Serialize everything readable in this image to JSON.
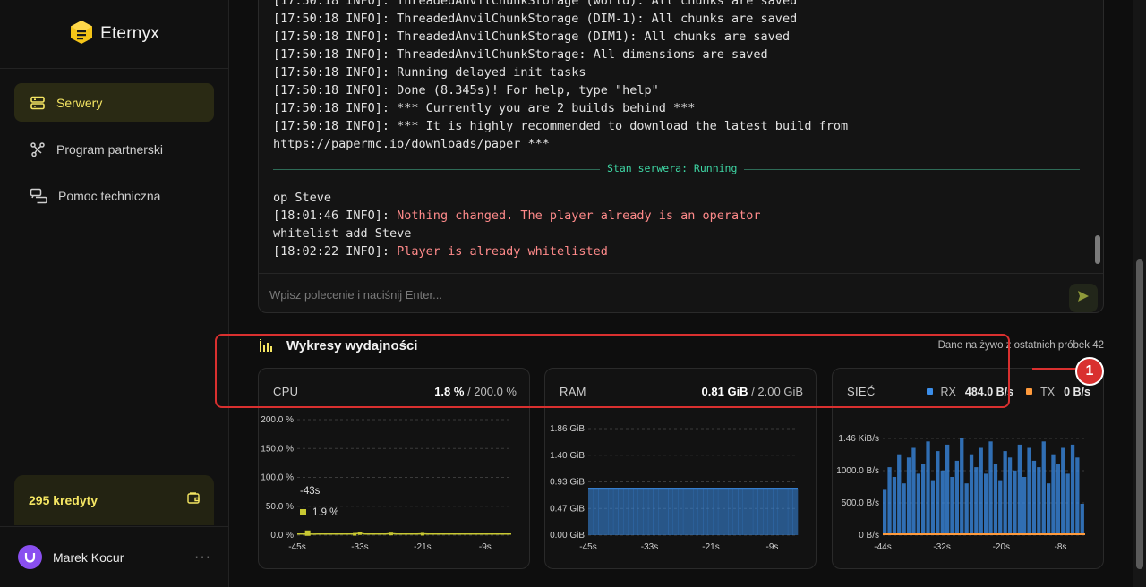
{
  "sidebar": {
    "brand": "Eternyx",
    "items": [
      {
        "label": "Serwery",
        "active": true,
        "icon": "server-icon"
      },
      {
        "label": "Program partnerski",
        "active": false,
        "icon": "share-icon"
      },
      {
        "label": "Pomoc techniczna",
        "active": false,
        "icon": "chat-icon"
      }
    ],
    "credits": "295 kredyty",
    "user": {
      "name": "Marek Kocur",
      "menu": "···"
    }
  },
  "console": {
    "lines_before": [
      {
        "prefix": "[17:50:18 INFO]: ",
        "text": "ThreadedAnvilChunkStorage (world): All chunks are saved"
      },
      {
        "prefix": "[17:50:18 INFO]: ",
        "text": "ThreadedAnvilChunkStorage (DIM-1): All chunks are saved"
      },
      {
        "prefix": "[17:50:18 INFO]: ",
        "text": "ThreadedAnvilChunkStorage (DIM1): All chunks are saved"
      },
      {
        "prefix": "[17:50:18 INFO]: ",
        "text": "ThreadedAnvilChunkStorage: All dimensions are saved"
      },
      {
        "prefix": "[17:50:18 INFO]: ",
        "text": "Running delayed init tasks"
      },
      {
        "prefix": "[17:50:18 INFO]: ",
        "text": "Done (8.345s)! For help, type \"help\""
      },
      {
        "prefix": "[17:50:18 INFO]: ",
        "text": "*** Currently you are 2 builds behind ***"
      },
      {
        "prefix": "[17:50:18 INFO]: ",
        "text": "*** It is highly recommended to download the latest build from"
      },
      {
        "prefix": "",
        "text": "https://papermc.io/downloads/paper ***"
      }
    ],
    "divider_label": "Stan serwera: Running",
    "lines_after": [
      {
        "prefix": "",
        "text": "op Steve",
        "warn": false
      },
      {
        "prefix": "[18:01:46 INFO]: ",
        "text": "Nothing changed. The player already is an operator",
        "warn": true
      },
      {
        "prefix": "",
        "text": "whitelist add Steve",
        "warn": false
      },
      {
        "prefix": "[18:02:22 INFO]: ",
        "text": "Player is already whitelisted",
        "warn": true
      }
    ],
    "input_placeholder": "Wpisz polecenie i naciśnij Enter..."
  },
  "performance": {
    "title": "Wykresy wydajności",
    "subtitle": "Dane na żywo z ostatnich próbek 42",
    "annotation_number": "1"
  },
  "cards": {
    "cpu": {
      "name": "CPU",
      "value": "1.8 %",
      "max": " / 200.0 %",
      "tooltip_time": "-43s",
      "tooltip_value": "1.9 %"
    },
    "ram": {
      "name": "RAM",
      "value": "0.81 GiB",
      "max": " / 2.00 GiB"
    },
    "net": {
      "name": "SIEĆ",
      "rx_label": "RX",
      "rx_value": "484.0 B/s",
      "tx_label": "TX",
      "tx_value": "0 B/s"
    }
  },
  "colors": {
    "accent": "#f5e663",
    "rx": "#3b8eea",
    "tx": "#ff9a3c",
    "cpu": "#c8c832",
    "annotation": "#d9302f"
  },
  "chart_data": [
    {
      "type": "line",
      "title": "CPU",
      "x": [
        -45,
        -44,
        -43,
        -42,
        -41,
        -40,
        -39,
        -38,
        -37,
        -36,
        -35,
        -34,
        -33,
        -32,
        -31,
        -30,
        -29,
        -28,
        -27,
        -26,
        -25,
        -24,
        -23,
        -22,
        -21,
        -20,
        -19,
        -18,
        -17,
        -16,
        -15,
        -14,
        -13,
        -12,
        -11,
        -10,
        -9,
        -8,
        -7,
        -6,
        -5,
        -4
      ],
      "y": [
        1.8,
        1.8,
        1.9,
        1.7,
        1.8,
        1.8,
        1.8,
        1.8,
        1.8,
        1.8,
        1.8,
        2.2,
        3.5,
        1.8,
        1.8,
        1.8,
        1.8,
        1.8,
        2.8,
        1.8,
        1.8,
        1.8,
        1.8,
        1.8,
        2.4,
        1.8,
        1.8,
        1.8,
        1.8,
        1.8,
        1.8,
        1.8,
        1.8,
        1.8,
        1.8,
        1.8,
        1.8,
        1.8,
        1.8,
        1.8,
        1.8,
        1.8
      ],
      "xticks": [
        "-45s",
        "-33s",
        "-21s",
        "-9s"
      ],
      "yticks": [
        "200.0 %",
        "150.0 %",
        "100.0 %",
        "50.0 %",
        "0.0 %"
      ],
      "ylim": [
        0,
        200
      ]
    },
    {
      "type": "area",
      "title": "RAM",
      "x": [
        -45,
        -44,
        -43,
        -42,
        -41,
        -40,
        -39,
        -38,
        -37,
        -36,
        -35,
        -34,
        -33,
        -32,
        -31,
        -30,
        -29,
        -28,
        -27,
        -26,
        -25,
        -24,
        -23,
        -22,
        -21,
        -20,
        -19,
        -18,
        -17,
        -16,
        -15,
        -14,
        -13,
        -12,
        -11,
        -10,
        -9,
        -8,
        -7,
        -6,
        -5,
        -4
      ],
      "y": [
        0.81,
        0.81,
        0.81,
        0.81,
        0.81,
        0.81,
        0.81,
        0.81,
        0.81,
        0.81,
        0.81,
        0.81,
        0.81,
        0.81,
        0.81,
        0.81,
        0.81,
        0.81,
        0.81,
        0.81,
        0.81,
        0.81,
        0.81,
        0.81,
        0.81,
        0.81,
        0.81,
        0.81,
        0.81,
        0.81,
        0.81,
        0.81,
        0.81,
        0.81,
        0.81,
        0.81,
        0.81,
        0.81,
        0.81,
        0.81,
        0.81,
        0.81
      ],
      "xticks": [
        "-45s",
        "-33s",
        "-21s",
        "-9s"
      ],
      "yticks": [
        "1.86 GiB",
        "1.40 GiB",
        "0.93 GiB",
        "0.47 GiB",
        "0.00 GiB"
      ],
      "ylim": [
        0,
        1.86
      ]
    },
    {
      "type": "area",
      "title": "SIEĆ",
      "x": [
        -44,
        -43,
        -42,
        -41,
        -40,
        -39,
        -38,
        -37,
        -36,
        -35,
        -34,
        -33,
        -32,
        -31,
        -30,
        -29,
        -28,
        -27,
        -26,
        -25,
        -24,
        -23,
        -22,
        -21,
        -20,
        -19,
        -18,
        -17,
        -16,
        -15,
        -14,
        -13,
        -12,
        -11,
        -10,
        -9,
        -8,
        -7,
        -6,
        -5,
        -4,
        -3
      ],
      "series": [
        {
          "name": "RX",
          "values": [
            700,
            1050,
            900,
            1250,
            800,
            1200,
            1350,
            950,
            1100,
            1450,
            850,
            1300,
            1000,
            1400,
            900,
            1150,
            1500,
            800,
            1250,
            1050,
            1350,
            950,
            1450,
            1100,
            850,
            1300,
            1200,
            1000,
            1400,
            900,
            1350,
            1150,
            1050,
            1450,
            800,
            1250,
            1100,
            1350,
            950,
            1400,
            1200,
            484
          ]
        },
        {
          "name": "TX",
          "values": [
            0,
            0,
            0,
            0,
            0,
            0,
            0,
            0,
            0,
            0,
            0,
            0,
            0,
            0,
            0,
            0,
            0,
            0,
            0,
            0,
            0,
            0,
            0,
            0,
            0,
            0,
            0,
            0,
            0,
            0,
            0,
            0,
            0,
            0,
            0,
            0,
            0,
            0,
            0,
            0,
            0,
            0
          ]
        }
      ],
      "xticks": [
        "-44s",
        "-32s",
        "-20s",
        "-8s"
      ],
      "yticks": [
        "1.46 KiB/s",
        "1000.0 B/s",
        "500.0 B/s",
        "0 B/s"
      ],
      "ylim": [
        0,
        1495
      ]
    }
  ]
}
